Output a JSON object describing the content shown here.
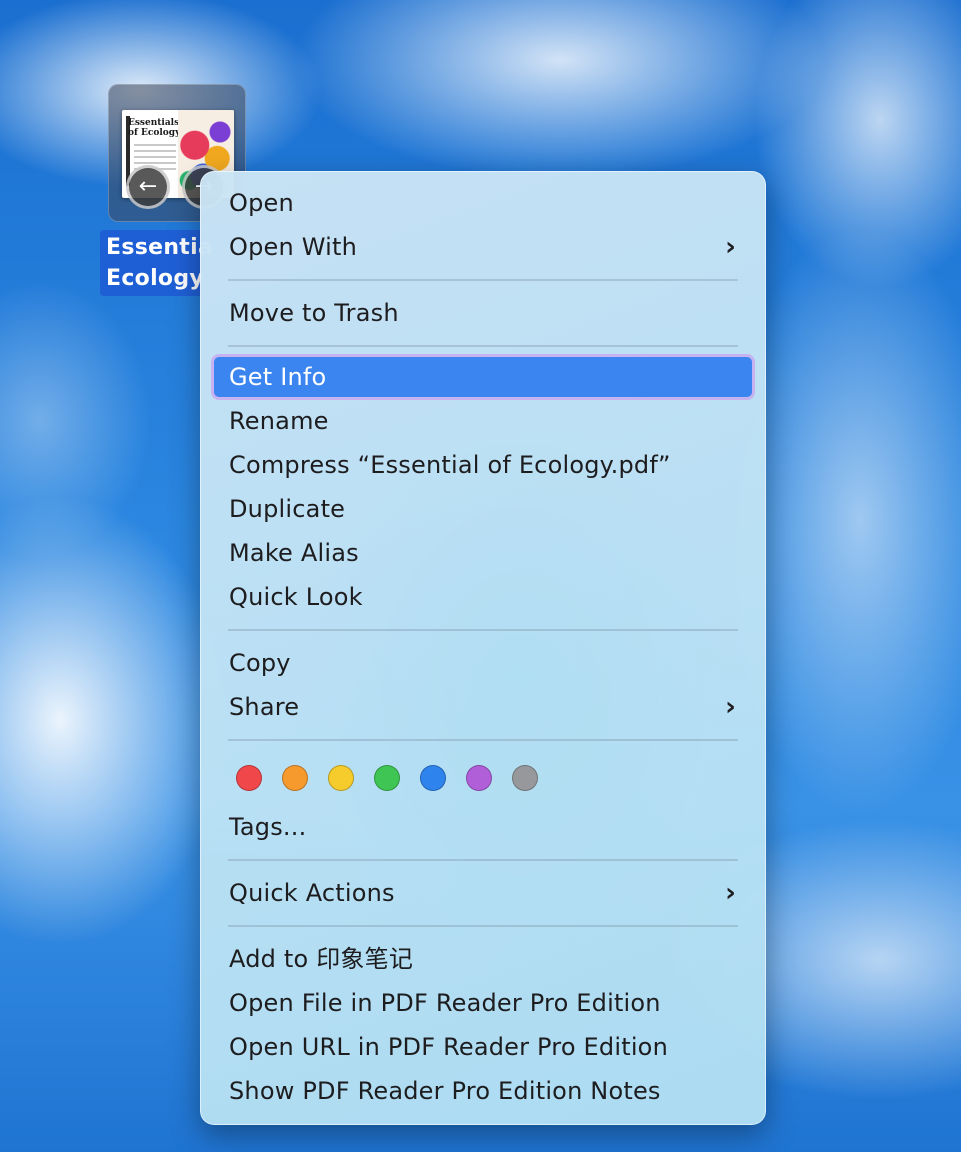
{
  "desktop": {
    "file": {
      "thumbnail_title": "Essentials of Ecology",
      "label_line1": "Essentia",
      "label_line2": "Ecology",
      "back_glyph": "←",
      "forward_glyph": "→"
    }
  },
  "menu": {
    "open": "Open",
    "open_with": "Open With",
    "move_to_trash": "Move to Trash",
    "get_info": "Get Info",
    "rename": "Rename",
    "compress": "Compress “Essential of Ecology.pdf”",
    "duplicate": "Duplicate",
    "make_alias": "Make Alias",
    "quick_look": "Quick Look",
    "copy": "Copy",
    "share": "Share",
    "tags": "Tags...",
    "quick_actions": "Quick Actions",
    "add_to_notes": "Add to 印象笔记",
    "open_file_pdf": "Open File in PDF Reader Pro Edition",
    "open_url_pdf": "Open URL in PDF Reader Pro Edition",
    "show_notes_pdf": "Show PDF Reader Pro Edition Notes",
    "submenu_glyph": "›",
    "highlighted_item": "Get Info"
  },
  "tag_colors": [
    {
      "name": "red",
      "hex": "#f0474a"
    },
    {
      "name": "orange",
      "hex": "#f69a2e"
    },
    {
      "name": "yellow",
      "hex": "#f5cc2c"
    },
    {
      "name": "green",
      "hex": "#3fc553"
    },
    {
      "name": "blue",
      "hex": "#2f83ec"
    },
    {
      "name": "purple",
      "hex": "#b15fd9"
    },
    {
      "name": "gray",
      "hex": "#96989b"
    }
  ],
  "colors": {
    "selection": "#3a85f0",
    "label_background": "#1f5fd6"
  }
}
